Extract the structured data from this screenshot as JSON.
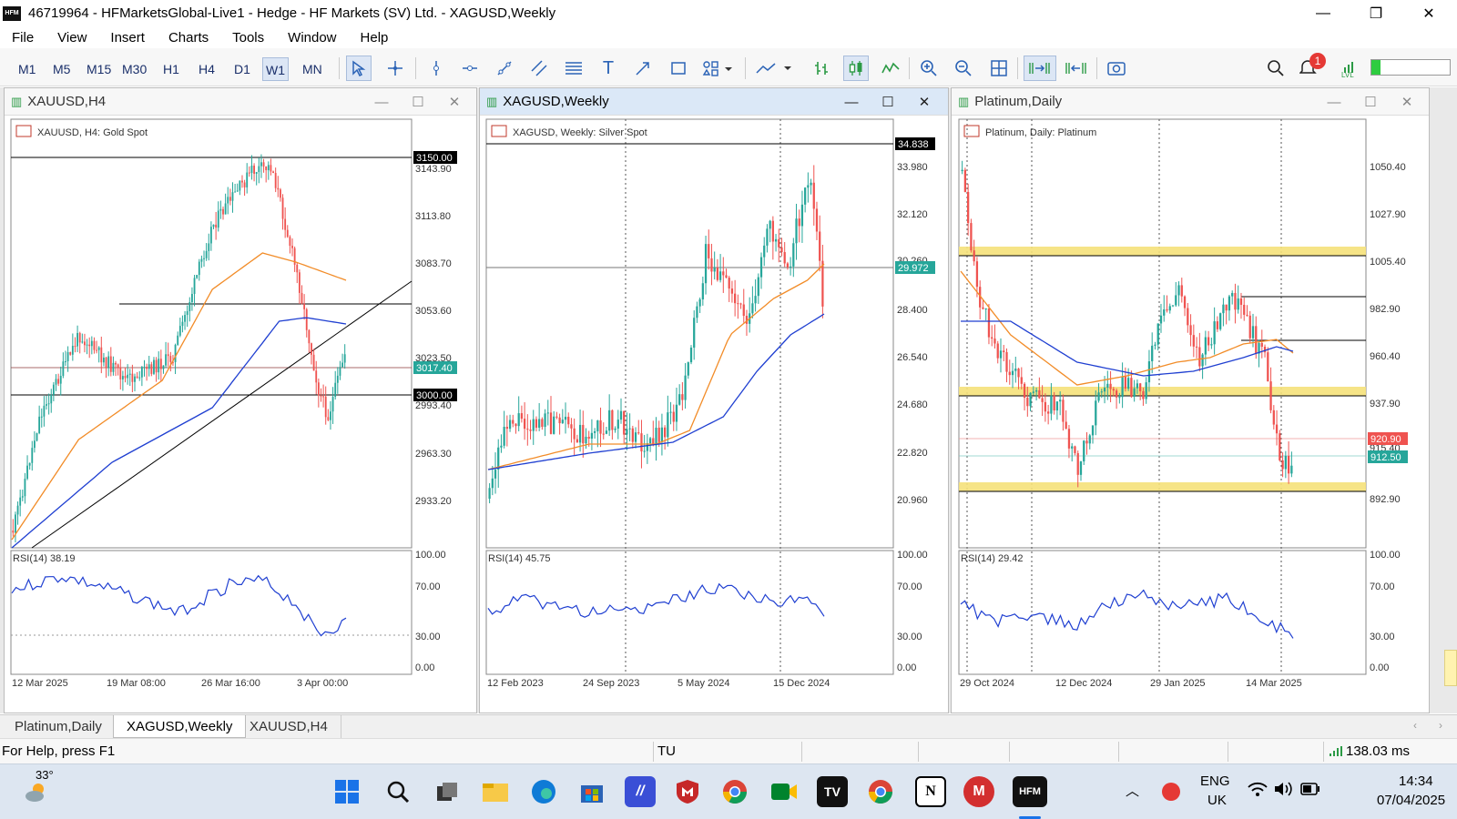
{
  "window": {
    "title": "46719964 - HFMarketsGlobal-Live1 - Hedge - HF Markets (SV) Ltd. - XAGUSD,Weekly",
    "app_icon": "HFM"
  },
  "menu": [
    "File",
    "View",
    "Insert",
    "Charts",
    "Tools",
    "Window",
    "Help"
  ],
  "toolbar": {
    "timeframes": [
      "M1",
      "M5",
      "M15",
      "M30",
      "H1",
      "H4",
      "D1",
      "W1",
      "MN"
    ],
    "selected_timeframe": "W1",
    "tools": [
      "cursor-icon",
      "crosshair-icon",
      "vertical-line-icon",
      "horizontal-line-icon",
      "trendline-icon",
      "equidistant-channel-icon",
      "fibonacci-icon",
      "text-icon",
      "arrow-icon",
      "rectangle-icon",
      "shapes-icon",
      "indicators-icon",
      "bar-chart-icon",
      "candlestick-icon",
      "line-chart-icon",
      "zoom-in-icon",
      "zoom-out-icon",
      "grid-icon",
      "autoscroll-icon",
      "chart-shift-icon",
      "screenshot-icon"
    ],
    "notification_count": "1",
    "right_icons": [
      "search-icon",
      "notification-icon",
      "signal-level-icon"
    ]
  },
  "charts": [
    {
      "window_title": "XAUUSD,H4",
      "label": "XAUUSD, H4:  Gold Spot",
      "price_axis": [
        "3143.90",
        "3113.80",
        "3083.70",
        "3053.60",
        "3023.50",
        "2993.40",
        "2963.30",
        "2933.20"
      ],
      "tags": [
        {
          "text": "3150.00",
          "color": "#000000"
        },
        {
          "text": "3017.40",
          "color": "#26a69a"
        },
        {
          "text": "3000.00",
          "color": "#000000"
        }
      ],
      "rsi_label": "RSI(14) 38.19",
      "rsi_axis": [
        "100.00",
        "70.00",
        "30.00",
        "0.00"
      ],
      "time_axis": [
        "12 Mar 2025",
        "19 Mar 08:00",
        "26 Mar 16:00",
        "3 Apr 00:00"
      ]
    },
    {
      "window_title": "XAGUSD,Weekly",
      "label": "XAGUSD, Weekly:  Silver Spot",
      "price_axis": [
        "33.980",
        "32.120",
        "30.260",
        "28.400",
        "26.540",
        "24.680",
        "22.820",
        "20.960"
      ],
      "tags": [
        {
          "text": "34.838",
          "color": "#000000"
        },
        {
          "text": "29.972",
          "color": "#26a69a"
        }
      ],
      "rsi_label": "RSI(14) 45.75",
      "rsi_axis": [
        "100.00",
        "70.00",
        "30.00",
        "0.00"
      ],
      "time_axis": [
        "12 Feb 2023",
        "24 Sep 2023",
        "5 May 2024",
        "15 Dec 2024"
      ]
    },
    {
      "window_title": "Platinum,Daily",
      "label": "Platinum, Daily:  Platinum",
      "price_axis": [
        "1050.40",
        "1027.90",
        "1005.40",
        "982.90",
        "960.40",
        "937.90",
        "915.40",
        "892.90"
      ],
      "tags": [
        {
          "text": "920.90",
          "color": "#ef5350"
        },
        {
          "text": "912.50",
          "color": "#26a69a"
        }
      ],
      "rsi_label": "RSI(14) 29.42",
      "rsi_axis": [
        "100.00",
        "70.00",
        "30.00",
        "0.00"
      ],
      "time_axis": [
        "29 Oct 2024",
        "12 Dec 2024",
        "29 Jan 2025",
        "14 Mar 2025"
      ]
    }
  ],
  "tabs": [
    "Platinum,Daily",
    "XAGUSD,Weekly",
    "XAUUSD,H4"
  ],
  "selected_tab": "XAGUSD,Weekly",
  "status": {
    "help": "For Help, press F1",
    "profile": "TU",
    "ping": "138.03 ms"
  },
  "taskbar": {
    "weather_temp": "33°",
    "apps": [
      "windows-start-icon",
      "search-icon",
      "task-view-icon",
      "file-explorer-icon",
      "edge-icon",
      "store-icon",
      "app-icon",
      "mcafee-icon",
      "chrome-icon",
      "meet-icon",
      "tradingview-icon",
      "chrome-profile-icon",
      "notion-icon",
      "mega-icon",
      "hfm-icon"
    ],
    "language": "ENG",
    "region": "UK",
    "time": "14:34",
    "date": "07/04/2025"
  },
  "colors": {
    "bull_candle": "#26a69a",
    "bear_candle": "#ef5350",
    "ma_fast": "#f28c28",
    "ma_slow": "#1f3fd1",
    "rsi": "#1f3fd1",
    "zone": "#f5e17a",
    "active_title": "#dbe8f7"
  }
}
